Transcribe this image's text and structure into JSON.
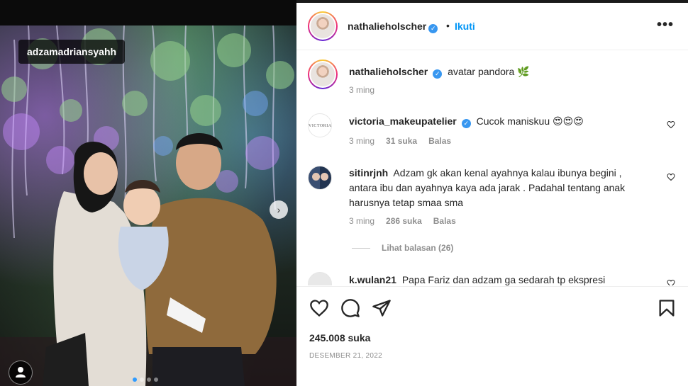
{
  "photo": {
    "tagged_user": "adzamadriansyahh",
    "carousel_dots": 4,
    "active_dot": 1,
    "next_icon": "chevron-right-icon",
    "user_tag_icon": "person-icon"
  },
  "header": {
    "username": "nathalieholscher",
    "separator": "•",
    "follow_label": "Ikuti",
    "more_icon": "more-horizontal-icon"
  },
  "caption": {
    "username": "nathalieholscher",
    "text": "avatar pandora 🌿",
    "time": "3 ming"
  },
  "comments": [
    {
      "username": "victoria_makeupatelier",
      "verified": true,
      "avatar_text": "VICTORIA",
      "text": "Cucok maniskuu 😍😍😍",
      "time": "3 ming",
      "likes": "31 suka",
      "reply": "Balas"
    },
    {
      "username": "sitinrjnh",
      "verified": false,
      "text_lines": [
        "Adzam gk akan kenal ayahnya kalau ibunya begini ,",
        "antara ibu dan ayahnya kaya ada jarak . Padahal tentang anak",
        "harusnya tetap smaa sma"
      ],
      "time": "3 ming",
      "likes": "286 suka",
      "reply": "Balas",
      "view_replies": "Lihat balasan (26)"
    },
    {
      "username": "k.wulan21",
      "verified": false,
      "text": "Papa Fariz dan adzam ga sedarah tp ekspresi"
    }
  ],
  "actions": {
    "like_icon": "heart-icon",
    "comment_icon": "comment-icon",
    "share_icon": "send-icon",
    "save_icon": "bookmark-icon",
    "likes_text": "245.008 suka",
    "date_text": "DESEMBER 21, 2022"
  },
  "colors": {
    "link_blue": "#0095f6",
    "verified_blue": "#3897f0",
    "muted": "#8e8e8e",
    "text": "#262626"
  }
}
